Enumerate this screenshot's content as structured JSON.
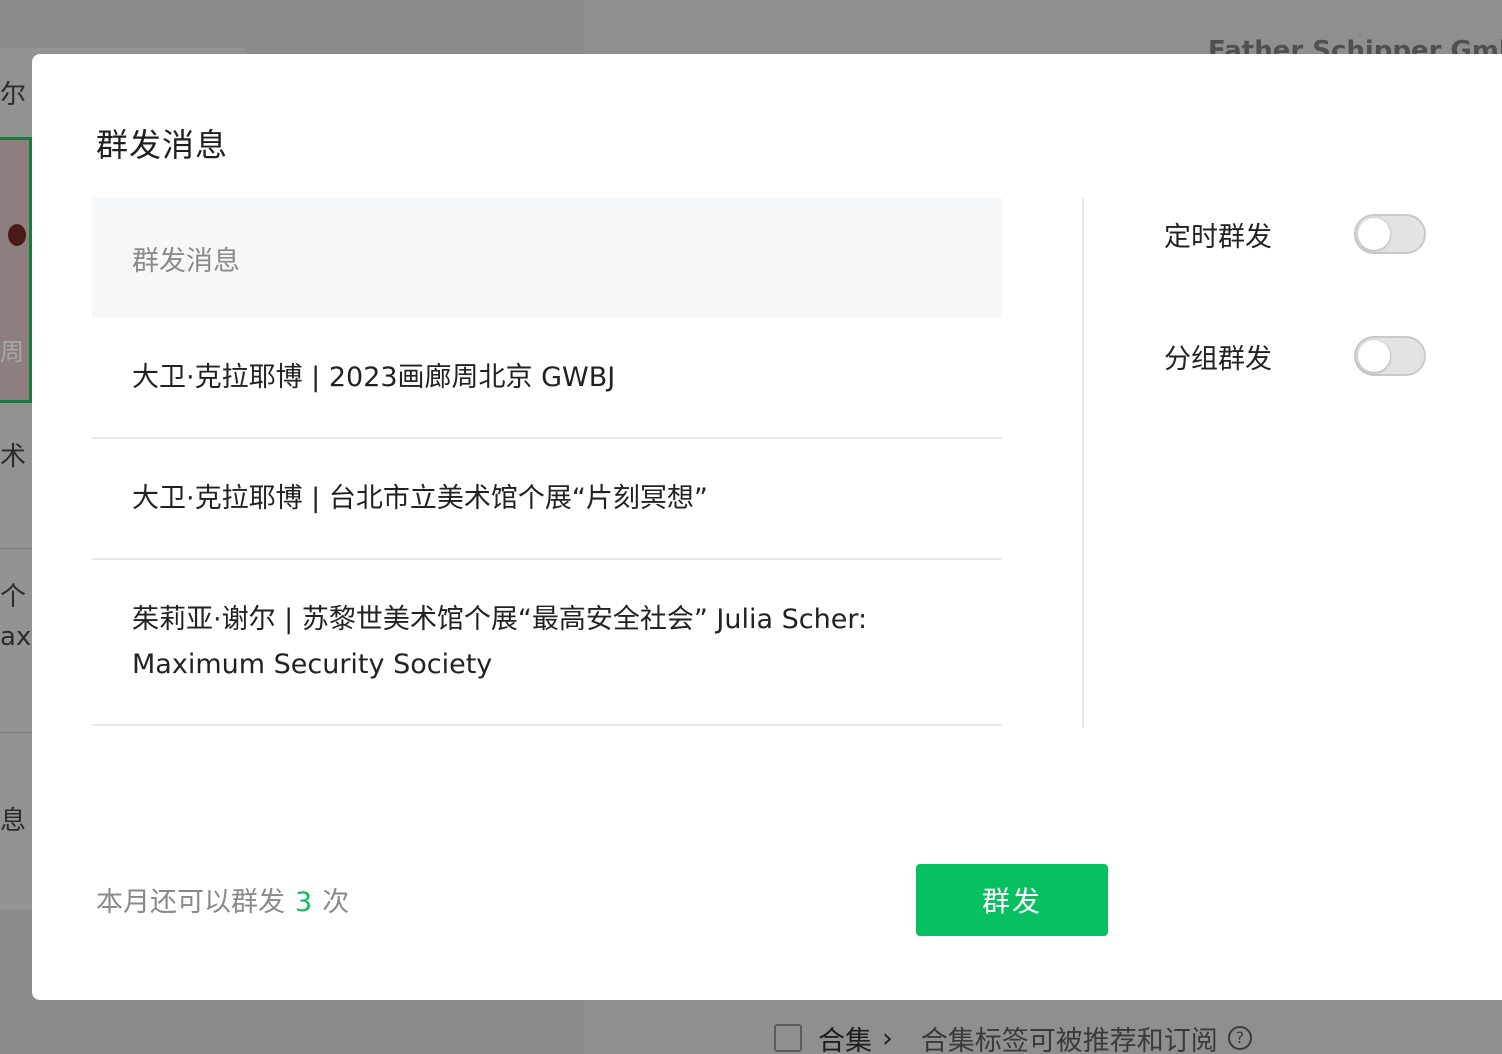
{
  "background": {
    "left_fragments": [
      "尔",
      "周",
      "术",
      "个",
      "axi",
      "息"
    ],
    "company_name": "Father Schipper GmbH",
    "bottom_row": {
      "collection_label": "合集",
      "chevron": "›",
      "hint": "合集标签可被推荐和订阅",
      "help_icon": "?"
    }
  },
  "modal": {
    "title": "群发消息",
    "list": {
      "header": "群发消息",
      "items": [
        "大卫·克拉耶博 | 2023画廊周北京 GWBJ",
        "大卫·克拉耶博 | 台北市立美术馆个展“片刻冥想”",
        "茱莉亚·谢尔 | 苏黎世美术馆个展“最高安全社会” Julia Scher: Maximum Security Society"
      ]
    },
    "options": [
      {
        "label": "定时群发",
        "enabled": false
      },
      {
        "label": "分组群发",
        "enabled": false
      }
    ],
    "footer": {
      "quota_prefix": "本月还可以群发",
      "quota_count": "3",
      "quota_suffix": "次"
    },
    "send_button": "群发"
  },
  "colors": {
    "accent_green": "#07c160",
    "overlay": "#8a8a8a"
  }
}
